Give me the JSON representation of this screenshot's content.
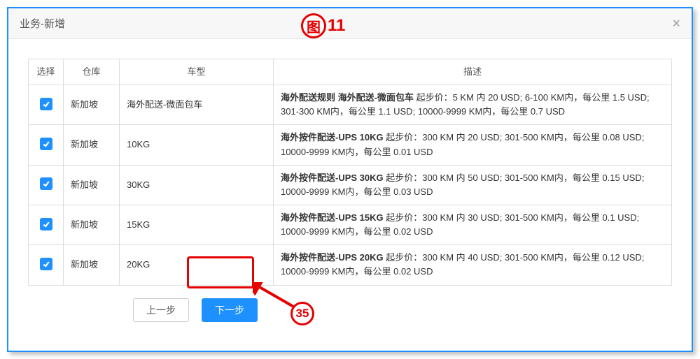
{
  "header": {
    "title": "业务-新增",
    "close": "×"
  },
  "annotations": {
    "figure_char": "图",
    "figure_num": "11",
    "step_badge": "35"
  },
  "table": {
    "headers": {
      "select": "选择",
      "warehouse": "仓库",
      "vehicle": "车型",
      "desc": "描述"
    },
    "rows": [
      {
        "warehouse": "新加坡",
        "vehicle": "海外配送-微面包车",
        "desc_bold": "海外配送规则 海外配送-微面包车",
        "desc_rest": " 起步价：5 KM 内 20 USD; 6-100 KM内，每公里 1.5 USD; 301-300 KM内，每公里 1.1 USD; 10000-9999 KM内，每公里 0.7 USD"
      },
      {
        "warehouse": "新加坡",
        "vehicle": "10KG",
        "desc_bold": "海外按件配送-UPS 10KG",
        "desc_rest": " 起步价：300 KM 内 20 USD; 301-500 KM内，每公里 0.08 USD; 10000-9999 KM内，每公里 0.01 USD"
      },
      {
        "warehouse": "新加坡",
        "vehicle": "30KG",
        "desc_bold": "海外按件配送-UPS 30KG",
        "desc_rest": " 起步价：300 KM 内 50 USD; 301-500 KM内，每公里 0.15 USD; 10000-9999 KM内，每公里 0.03 USD"
      },
      {
        "warehouse": "新加坡",
        "vehicle": "15KG",
        "desc_bold": "海外按件配送-UPS 15KG",
        "desc_rest": " 起步价：300 KM 内 30 USD; 301-500 KM内，每公里 0.1 USD; 10000-9999 KM内，每公里 0.02 USD"
      },
      {
        "warehouse": "新加坡",
        "vehicle": "20KG",
        "desc_bold": "海外按件配送-UPS 20KG",
        "desc_rest": " 起步价：300 KM 内 40 USD; 301-500 KM内，每公里 0.12 USD; 10000-9999 KM内，每公里 0.02 USD"
      }
    ]
  },
  "buttons": {
    "prev": "上一步",
    "next": "下一步"
  }
}
